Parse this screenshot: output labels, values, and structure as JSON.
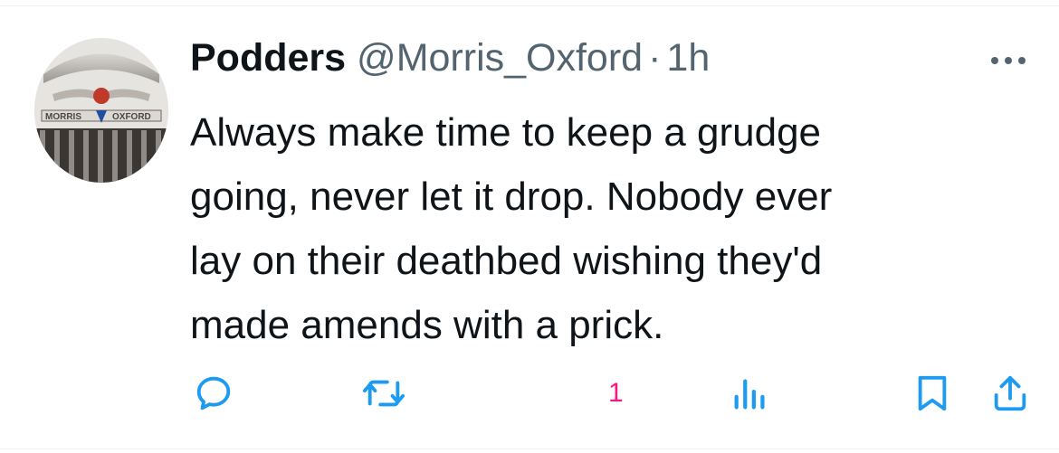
{
  "tweet": {
    "display_name": "Podders",
    "handle": "@Morris_Oxford",
    "separator": "·",
    "time": "1h",
    "avatar": {
      "badge_left": "MORRIS",
      "badge_right": "OXFORD"
    },
    "text_lines": [
      "Always make time to keep a grudge",
      "going, never let it drop. Nobody ever",
      "lay on their deathbed wishing they'd",
      "made amends with a prick."
    ],
    "like_count": "1"
  },
  "colors": {
    "text": "#0f1419",
    "secondary": "#536471",
    "like": "#f91880",
    "divider": "#eff3f4"
  },
  "icons": [
    "more-icon",
    "reply-icon",
    "retweet-icon",
    "like-count",
    "views-icon",
    "bookmark-icon",
    "share-icon"
  ]
}
